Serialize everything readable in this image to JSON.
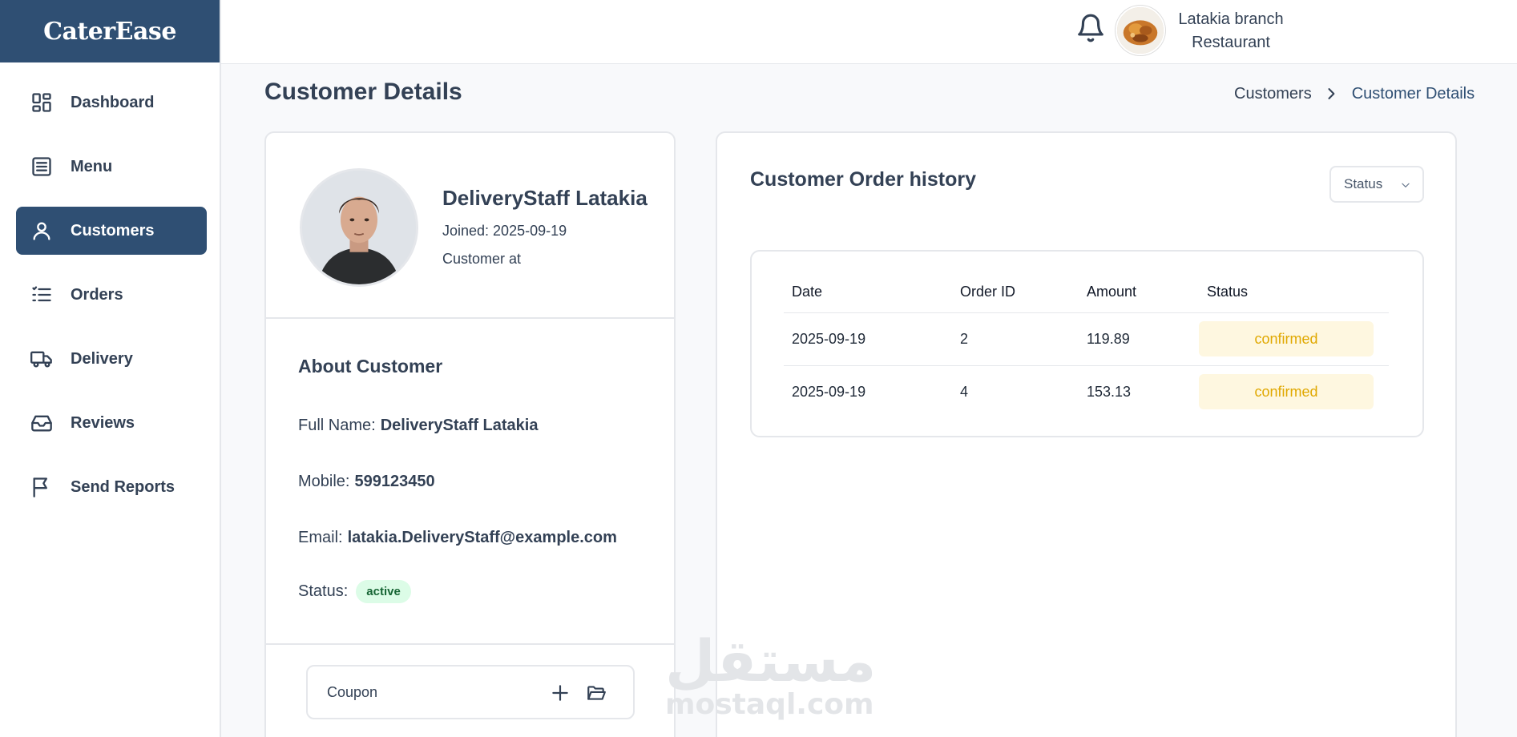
{
  "app": {
    "brand": "CaterEase"
  },
  "sidebar": {
    "items": [
      {
        "label": "Dashboard",
        "icon": "dashboard-icon",
        "active": false
      },
      {
        "label": "Menu",
        "icon": "menu-list-icon",
        "active": false
      },
      {
        "label": "Customers",
        "icon": "user-icon",
        "active": true
      },
      {
        "label": "Orders",
        "icon": "list-icon",
        "active": false
      },
      {
        "label": "Delivery",
        "icon": "truck-icon",
        "active": false
      },
      {
        "label": "Reviews",
        "icon": "inbox-icon",
        "active": false
      },
      {
        "label": "Send Reports",
        "icon": "flag-icon",
        "active": false
      }
    ]
  },
  "topbar": {
    "store_line1": "Latakia branch",
    "store_line2": "Restaurant"
  },
  "page": {
    "title": "Customer Details",
    "breadcrumb": {
      "parent": "Customers",
      "current": "Customer Details"
    }
  },
  "profile": {
    "name": "DeliveryStaff Latakia",
    "joined": "Joined: 2025-09-19",
    "customer_at": "Customer at"
  },
  "about": {
    "title": "About Customer",
    "full_name_label": "Full Name:",
    "full_name": "DeliveryStaff Latakia",
    "mobile_label": "Mobile:",
    "mobile": "599123450",
    "email_label": "Email:",
    "email": "latakia.DeliveryStaff@example.com",
    "status_label": "Status:",
    "status": "active"
  },
  "coupon": {
    "label": "Coupon"
  },
  "orders": {
    "title": "Customer Order history",
    "filter_label": "Status",
    "columns": [
      "Date",
      "Order ID",
      "Amount",
      "Status"
    ],
    "rows": [
      {
        "date": "2025-09-19",
        "order_id": "2",
        "amount": "119.89",
        "status": "confirmed"
      },
      {
        "date": "2025-09-19",
        "order_id": "4",
        "amount": "153.13",
        "status": "confirmed"
      }
    ]
  },
  "watermark": {
    "arabic": "مستقل",
    "latin": "mostaql.com"
  },
  "colors": {
    "primary": "#2f4f73",
    "active_badge_bg": "#dcfce7",
    "confirmed_text": "#e0a800",
    "confirmed_bg": "#fef7e0"
  }
}
